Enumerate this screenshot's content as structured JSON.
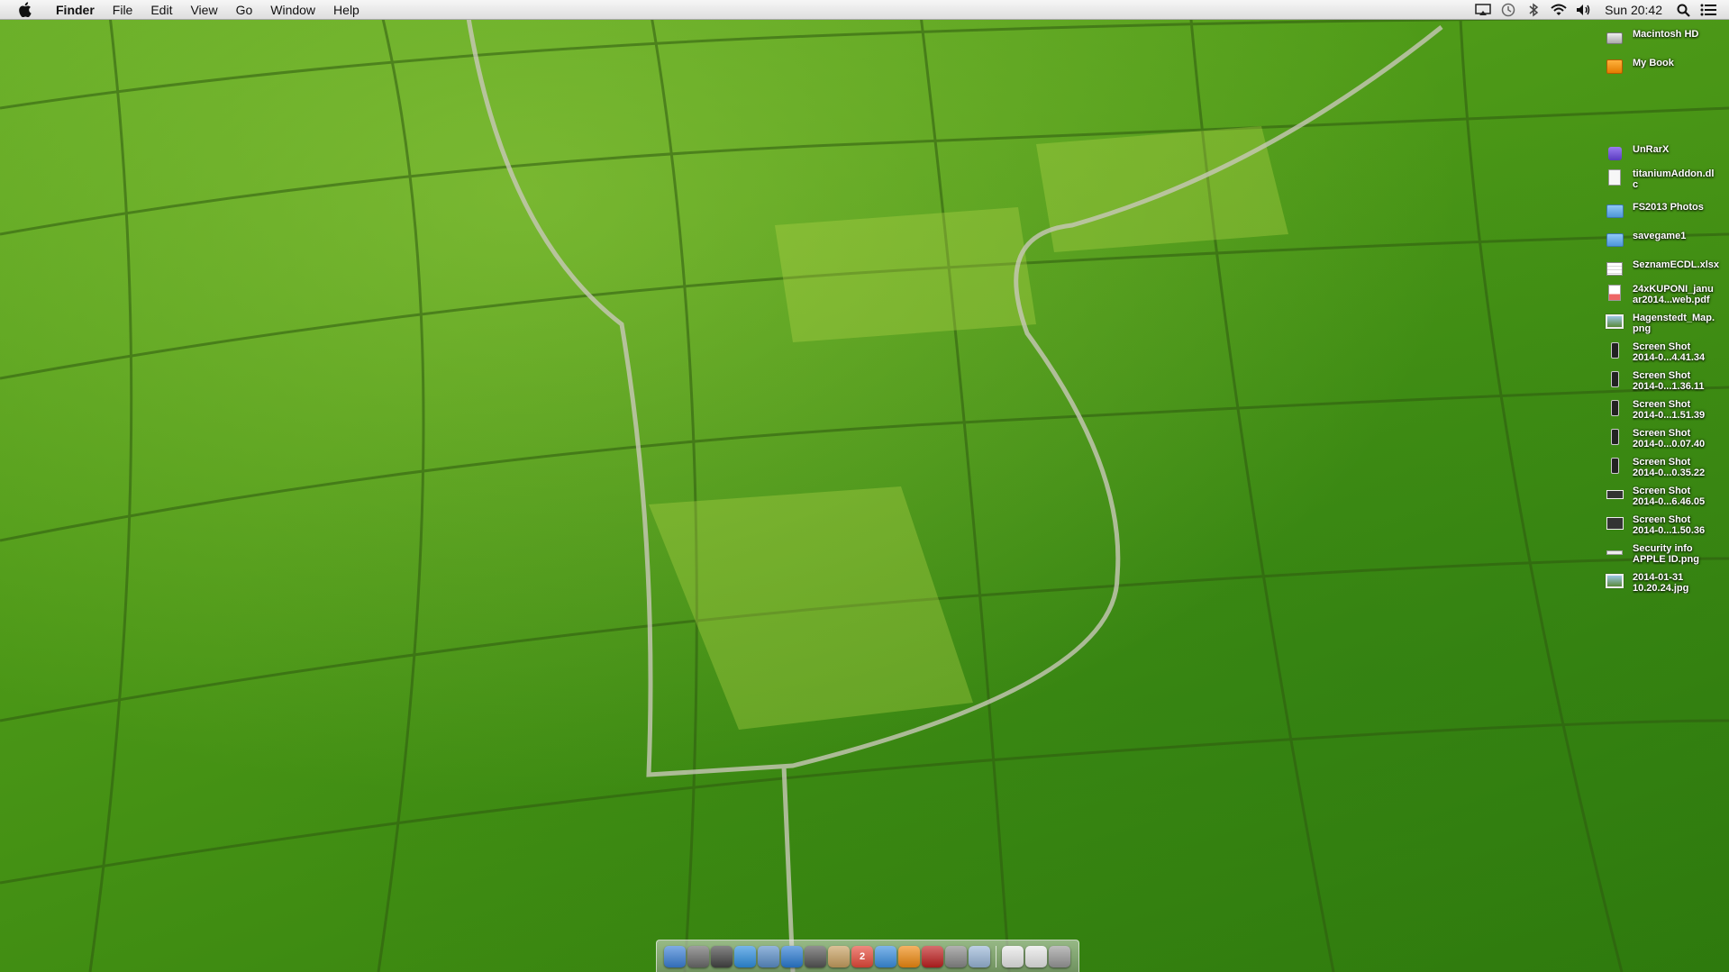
{
  "menubar": {
    "apple_icon": "apple-icon",
    "app_name": "Finder",
    "menus": [
      "File",
      "Edit",
      "View",
      "Go",
      "Window",
      "Help"
    ],
    "status_icons": [
      "airplay-icon",
      "time-machine-icon",
      "bluetooth-icon",
      "wifi-icon",
      "volume-icon"
    ],
    "clock": "Sun 20:42",
    "spotlight_icon": "search-icon",
    "notification_icon": "list-icon"
  },
  "desktop_icons": [
    {
      "label": "Macintosh HD",
      "icon": "hard-drive-icon"
    },
    {
      "label": "My Book",
      "icon": "external-drive-icon"
    },
    {
      "label": "UnRarX",
      "icon": "app-icon"
    },
    {
      "label": "titaniumAddon.dl\nc",
      "icon": "document-icon"
    },
    {
      "label": "FS2013 Photos",
      "icon": "folder-icon"
    },
    {
      "label": "savegame1",
      "icon": "folder-icon"
    },
    {
      "label": "SeznamECDL.xlsx",
      "icon": "spreadsheet-icon"
    },
    {
      "label": "24xKUPONI_janu\nar2014...web.pdf",
      "icon": "pdf-icon"
    },
    {
      "label": "Hagenstedt_Map.\npng",
      "icon": "image-icon"
    },
    {
      "label": "Screen Shot\n2014-0...4.41.34",
      "icon": "screenshot-icon"
    },
    {
      "label": "Screen Shot\n2014-0...1.36.11",
      "icon": "screenshot-icon"
    },
    {
      "label": "Screen Shot\n2014-0...1.51.39",
      "icon": "screenshot-icon"
    },
    {
      "label": "Screen Shot\n2014-0...0.07.40",
      "icon": "screenshot-icon"
    },
    {
      "label": "Screen Shot\n2014-0...0.35.22",
      "icon": "screenshot-icon"
    },
    {
      "label": "Screen Shot\n2014-0...6.46.05",
      "icon": "screenshot-icon"
    },
    {
      "label": "Screen Shot\n2014-0...1.50.36",
      "icon": "screenshot-icon"
    },
    {
      "label": "Security info\nAPPLE ID.png",
      "icon": "image-icon"
    },
    {
      "label": "2014-01-31\n10.20.24.jpg",
      "icon": "image-icon"
    }
  ],
  "dock": {
    "apps": [
      {
        "name": "finder-icon",
        "color": "#3a7fd6"
      },
      {
        "name": "launchpad-icon",
        "color": "#6b6b6b"
      },
      {
        "name": "mission-control-icon",
        "color": "#444444"
      },
      {
        "name": "app-store-icon",
        "color": "#2e8fe0"
      },
      {
        "name": "mail-icon",
        "color": "#5b8fc9"
      },
      {
        "name": "safari-icon",
        "color": "#2a7bd3"
      },
      {
        "name": "facetime-icon",
        "color": "#555555"
      },
      {
        "name": "contacts-icon",
        "color": "#c8a060"
      },
      {
        "name": "calendar-icon",
        "color": "#e84a3a",
        "badge": "2"
      },
      {
        "name": "itunes-icon",
        "color": "#3a8fe0"
      },
      {
        "name": "ibooks-icon",
        "color": "#f08a10"
      },
      {
        "name": "photo-booth-icon",
        "color": "#c02020"
      },
      {
        "name": "system-preferences-icon",
        "color": "#888888"
      },
      {
        "name": "preview-icon",
        "color": "#9ab7d8"
      }
    ],
    "stacks": [
      {
        "name": "documents-stack-icon",
        "color": "#e8e8e8"
      },
      {
        "name": "downloads-stack-icon",
        "color": "#e8e8e8"
      },
      {
        "name": "trash-icon",
        "color": "#9a9a9a"
      }
    ]
  }
}
